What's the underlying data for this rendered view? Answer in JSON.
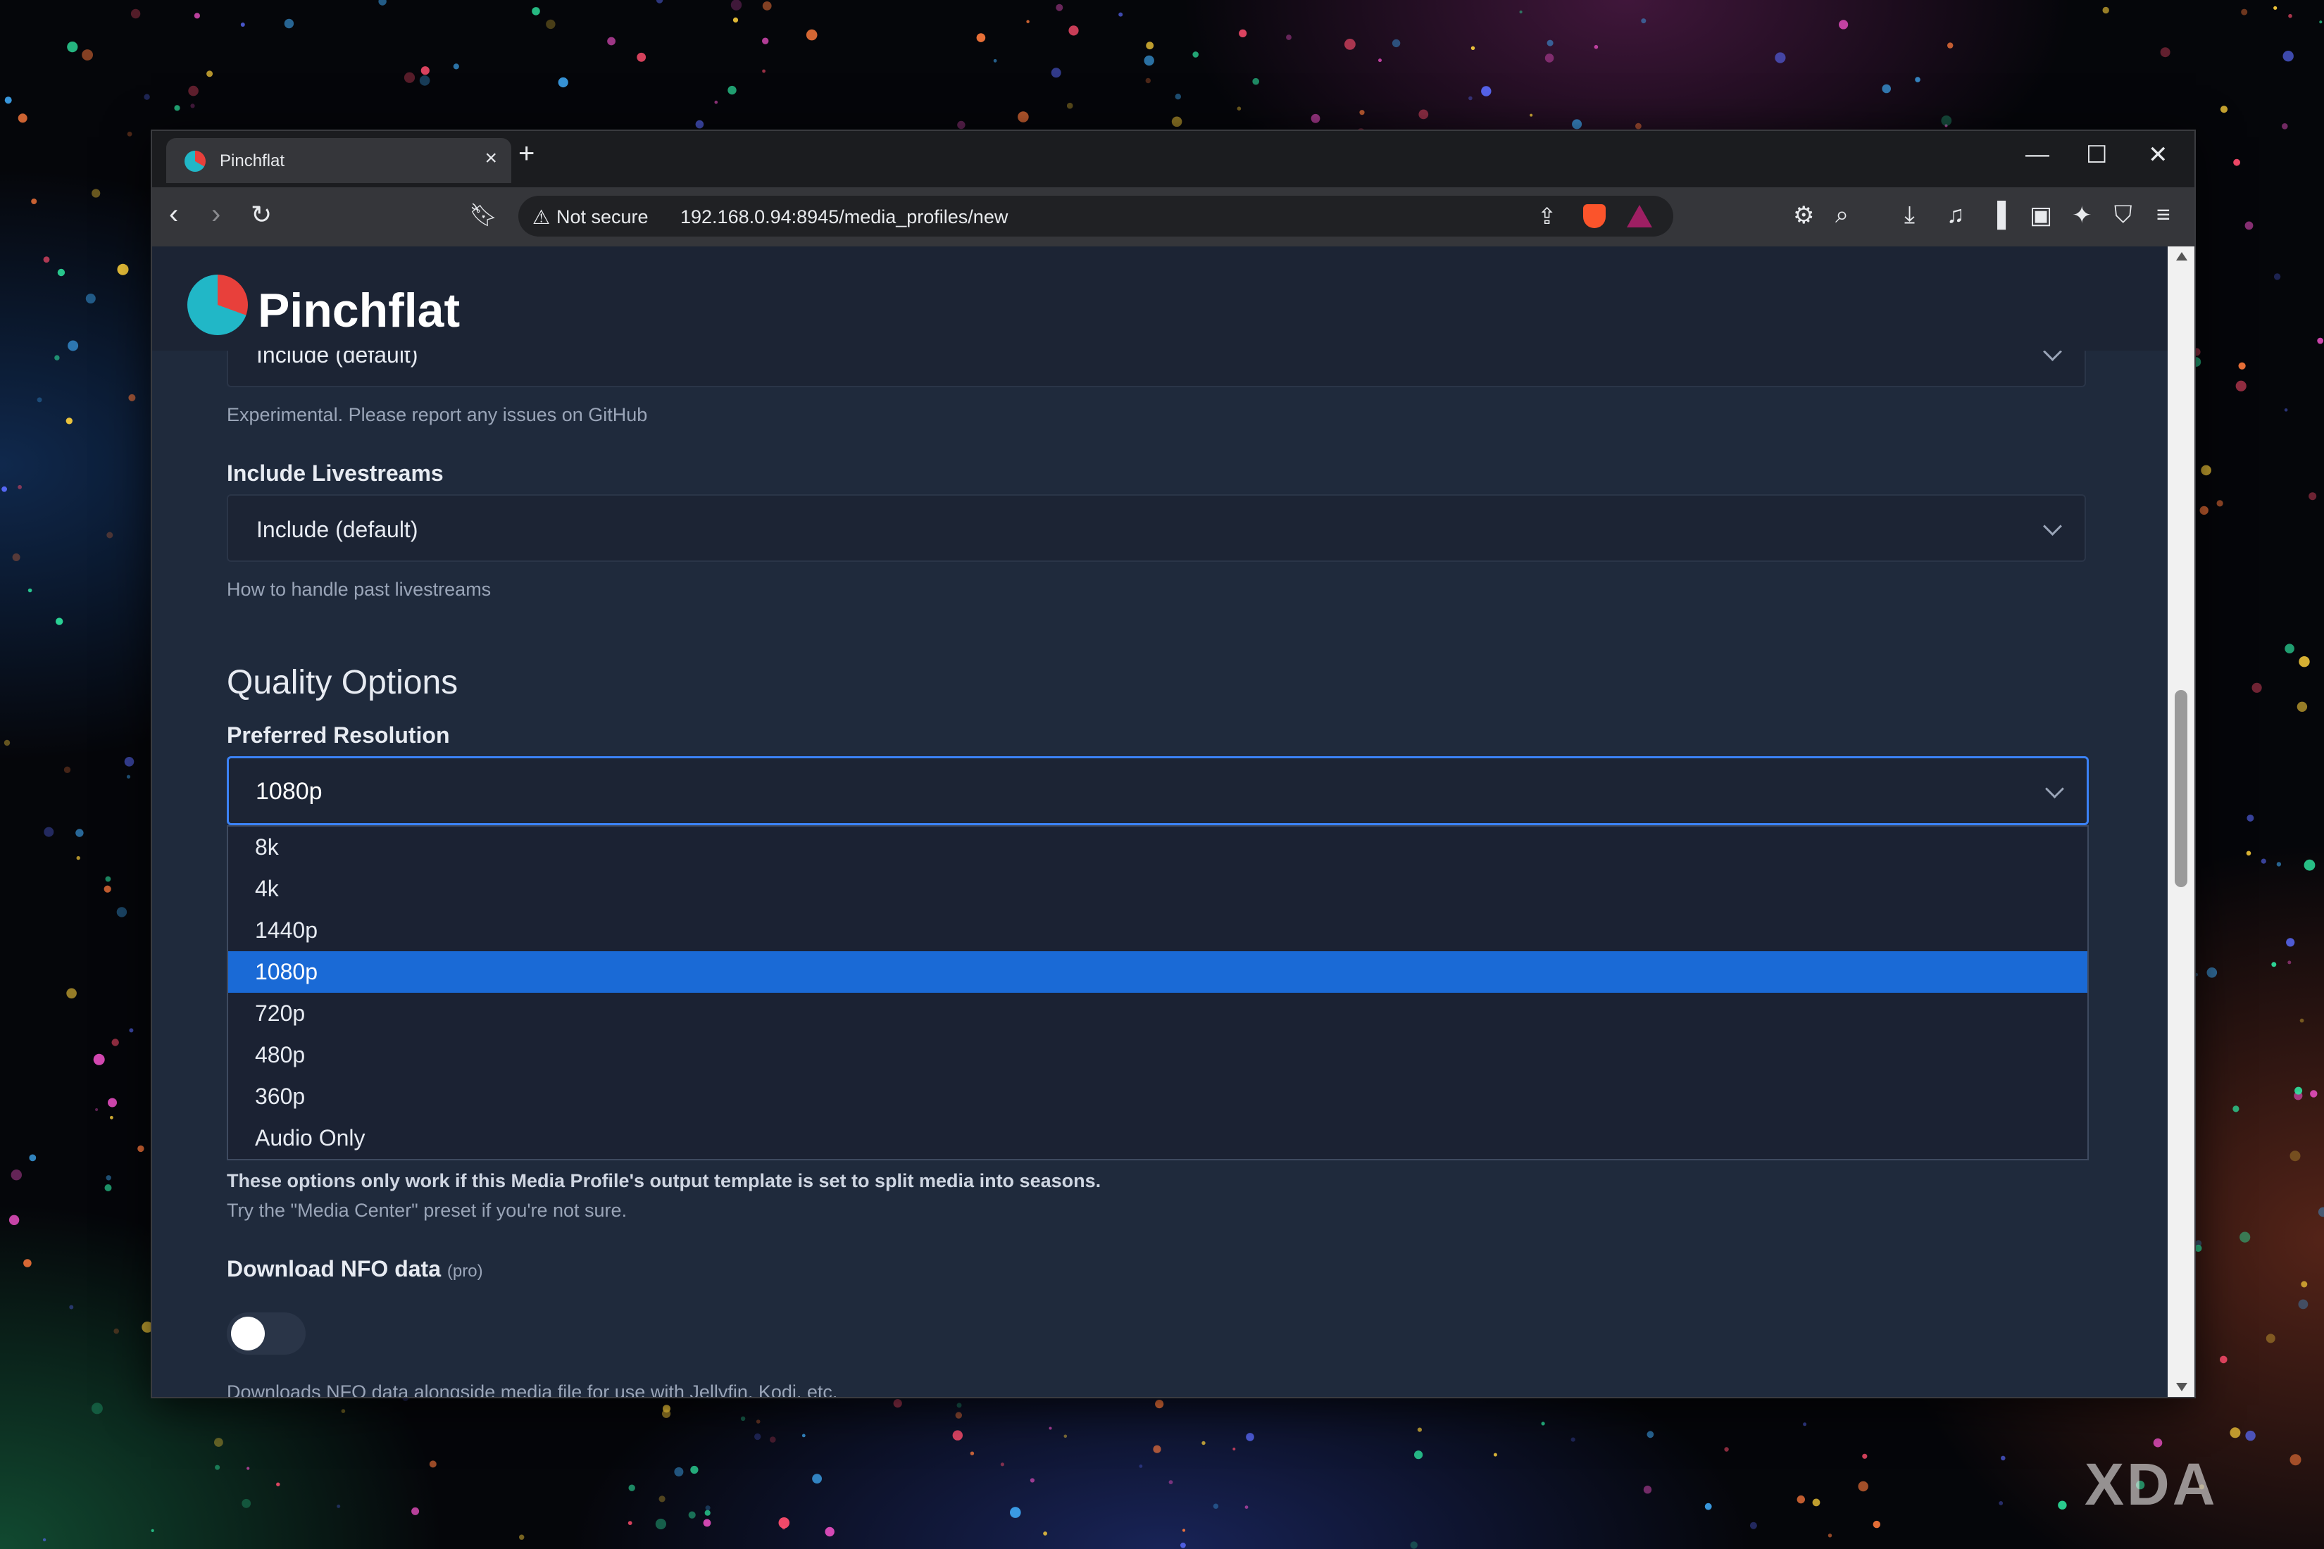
{
  "browser": {
    "tab_title": "Pinchflat",
    "security_label": "Not secure",
    "url": "192.168.0.94:8945/media_profiles/new"
  },
  "app": {
    "name": "Pinchflat"
  },
  "form": {
    "prev_select_value": "Include (default)",
    "prev_help": "Experimental. Please report any issues on GitHub",
    "livestreams": {
      "label": "Include Livestreams",
      "value": "Include (default)",
      "help": "How to handle past livestreams"
    },
    "quality_title": "Quality Options",
    "resolution": {
      "label": "Preferred Resolution",
      "value": "1080p",
      "options": [
        "8k",
        "4k",
        "1440p",
        "1080p",
        "720p",
        "480p",
        "360p",
        "Audio Only"
      ],
      "selected_index": 3
    },
    "seasons_note_bold": "These options only work if this Media Profile's output template is set to split media into seasons.",
    "seasons_note": "Try the \"Media Center\" preset if you're not sure.",
    "nfo": {
      "label": "Download NFO data",
      "badge": "(pro)",
      "enabled": false,
      "help": "Downloads NFO data alongside media file for use with Jellyfin, Kodi, etc."
    }
  },
  "watermark": "XDA",
  "colors": {
    "page_bg": "#1f2a3c",
    "header_bg": "#1c2434",
    "focus_border": "#3b82f6",
    "selected_option": "#1a6ad6",
    "logo_red": "#e8403b",
    "logo_teal": "#21b7c7"
  }
}
